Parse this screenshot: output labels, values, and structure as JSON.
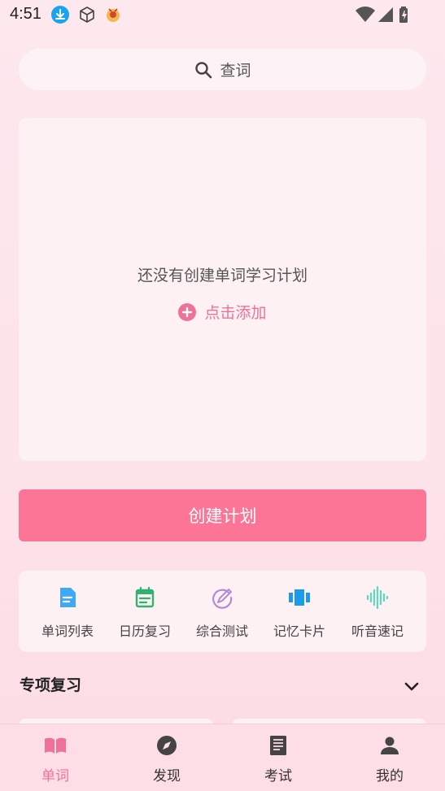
{
  "status_bar": {
    "time": "4:51"
  },
  "search": {
    "label": "查词"
  },
  "plan": {
    "empty_text": "还没有创建单词学习计划",
    "add_label": "点击添加"
  },
  "create_button": {
    "label": "创建计划"
  },
  "tools": [
    {
      "label": "单词列表",
      "icon": "document-icon",
      "color": "#3fa9f5"
    },
    {
      "label": "日历复习",
      "icon": "calendar-icon",
      "color": "#2fb36e"
    },
    {
      "label": "综合测试",
      "icon": "pencil-circle-icon",
      "color": "#b28ad8"
    },
    {
      "label": "记忆卡片",
      "icon": "cards-icon",
      "color": "#1e9be8"
    },
    {
      "label": "听音速记",
      "icon": "audio-wave-icon",
      "color": "#5fd6c0"
    }
  ],
  "section": {
    "title": "专项复习"
  },
  "bottom_nav": [
    {
      "label": "单词",
      "icon": "book-icon",
      "active": true
    },
    {
      "label": "发现",
      "icon": "compass-icon",
      "active": false
    },
    {
      "label": "考试",
      "icon": "exam-paper-icon",
      "active": false
    },
    {
      "label": "我的",
      "icon": "person-icon",
      "active": false
    }
  ],
  "colors": {
    "accent": "#fd7596",
    "accent_text": "#f0709a",
    "background": "#fde8ee"
  }
}
